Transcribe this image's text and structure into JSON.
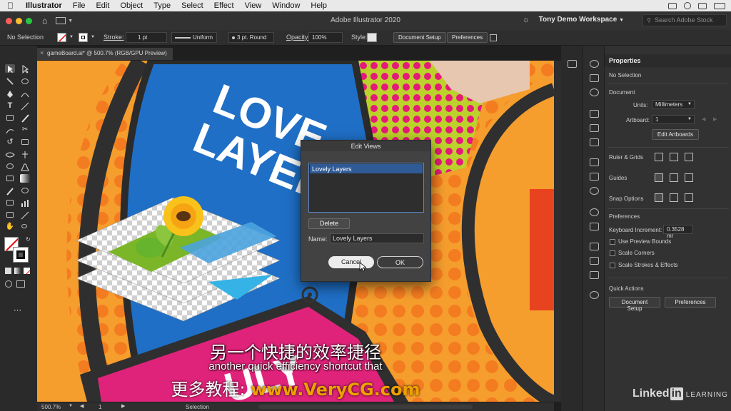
{
  "menubar": {
    "apple_icon": "apple-icon",
    "items": [
      "Illustrator",
      "File",
      "Edit",
      "Object",
      "Type",
      "Select",
      "Effect",
      "View",
      "Window",
      "Help"
    ]
  },
  "appbar": {
    "title": "Adobe Illustrator 2020",
    "workspace": "Tony Demo Workspace",
    "search_placeholder": "Search Adobe Stock"
  },
  "controlbar": {
    "selection": "No Selection",
    "stroke_label": "Stroke:",
    "stroke_value": "1 pt",
    "profile": "Uniform",
    "brush": "3 pt. Round",
    "opacity_label": "Opacity:",
    "opacity_value": "100%",
    "style_label": "Style:",
    "document_setup": "Document Setup",
    "preferences": "Preferences"
  },
  "document": {
    "tab": "gameBoard.ai* @ 500.7% (RGB/GPU Preview)"
  },
  "artwork": {
    "line1": "LOVE",
    "line2": "LAYER",
    "bottom_text": "ULY"
  },
  "statusbar": {
    "zoom": "500.7%",
    "artboard": "1",
    "mode": "Selection"
  },
  "dialog": {
    "title": "Edit Views",
    "list_items": [
      "Lovely Layers"
    ],
    "delete_label": "Delete",
    "name_label": "Name:",
    "name_value": "Lovely Layers",
    "cancel_label": "Cancel",
    "ok_label": "OK"
  },
  "properties": {
    "tab": "Properties",
    "selection": "No Selection",
    "document_header": "Document",
    "units_label": "Units:",
    "units_value": "Millimeters",
    "artboard_label": "Artboard:",
    "artboard_value": "1",
    "edit_artboards": "Edit Artboards",
    "rulers_grids": "Ruler & Grids",
    "guides": "Guides",
    "snap_options": "Snap Options",
    "preferences_header": "Preferences",
    "keyboard_increment_label": "Keyboard Increment:",
    "keyboard_increment_value": "0.3528 mr",
    "use_preview_bounds": "Use Preview Bounds",
    "scale_corners": "Scale Corners",
    "scale_strokes": "Scale Strokes & Effects",
    "quick_actions": "Quick Actions",
    "qa_document_setup": "Document Setup",
    "qa_preferences": "Preferences"
  },
  "subtitles": {
    "chinese": "另一个快捷的效率捷径",
    "english": "another quick efficiency shortcut that",
    "ad_prefix": "更多教程: ",
    "ad_url": "www.VeryCG.com"
  },
  "watermark": {
    "brand": "Linked",
    "brand_box": "in",
    "learning": "LEARNING"
  },
  "colors": {
    "orange": "#f19a2a",
    "blue": "#1f6fc6",
    "magenta": "#e0237a",
    "lime": "#b6cf2a",
    "dialog_selection": "#2f5a96"
  }
}
